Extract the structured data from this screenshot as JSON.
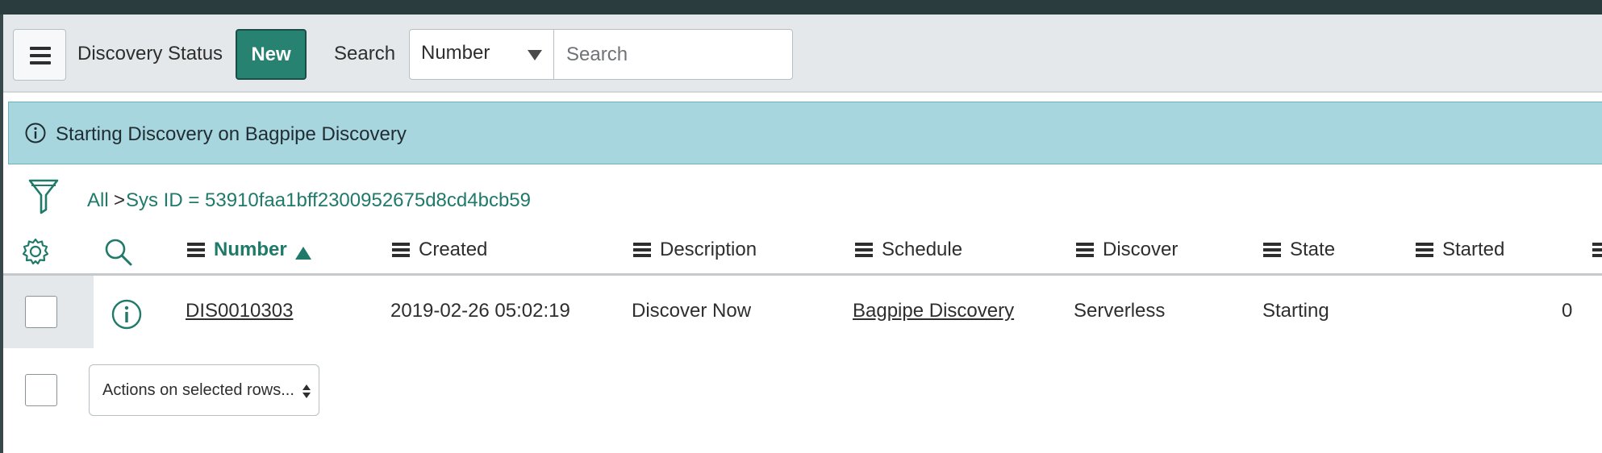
{
  "header": {
    "list_title": "Discovery Status",
    "new_label": "New",
    "search_label": "Search",
    "search_field": "Number",
    "search_placeholder": "Search"
  },
  "banner": {
    "message": "Starting Discovery on Bagpipe Discovery",
    "color": "#a8d6de"
  },
  "breadcrumb": {
    "all": "All",
    "separator": ">",
    "filter": "Sys ID = 53910faa1bff2300952675d8cd4bcb59"
  },
  "columns": {
    "number": "Number",
    "created": "Created",
    "description": "Description",
    "schedule": "Schedule",
    "discover": "Discover",
    "state": "State",
    "started": "Started"
  },
  "rows": [
    {
      "number": "DIS0010303",
      "created": "2019-02-26 05:02:19",
      "description": "Discover Now",
      "schedule": "Bagpipe Discovery",
      "discover": "Serverless",
      "state": "Starting",
      "started": "",
      "count": "0"
    }
  ],
  "footer": {
    "actions_label": "Actions on selected rows..."
  },
  "colors": {
    "accent": "#278272",
    "link": "#1f7a6a",
    "header_bg": "#e4e8ea"
  }
}
